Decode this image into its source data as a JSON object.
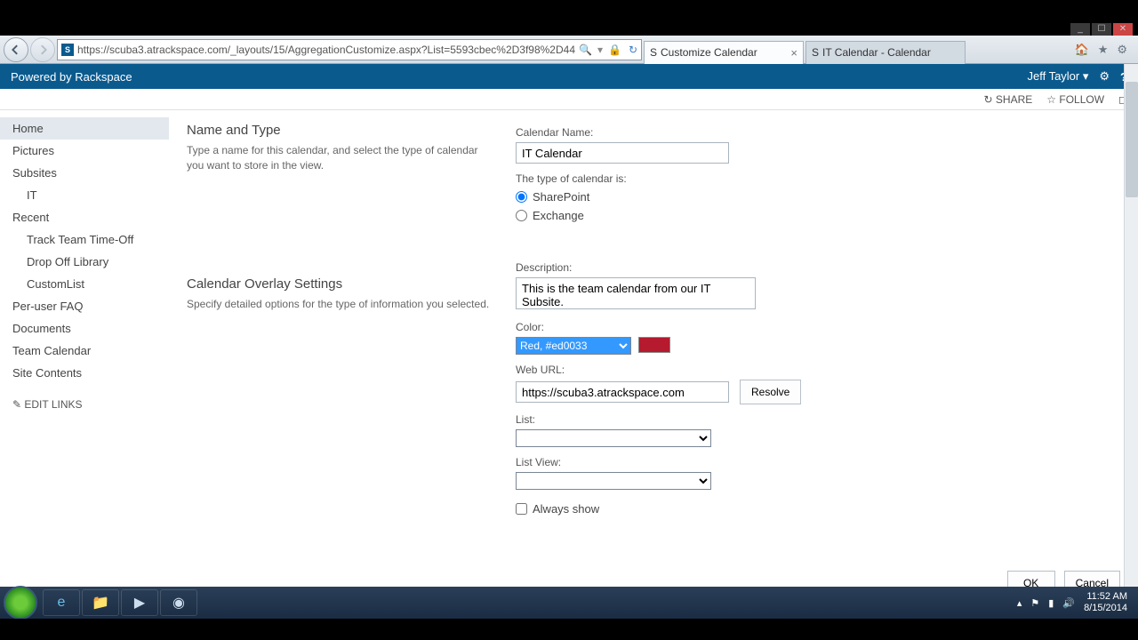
{
  "window": {
    "min": "_",
    "max": "☐",
    "close": "✕"
  },
  "browser": {
    "url": "https://scuba3.atrackspace.com/_layouts/15/AggregationCustomize.aspx?List=5593cbec%2D3f98%2D44",
    "tab1": "Customize Calendar",
    "tab2": "IT Calendar - Calendar"
  },
  "banner": {
    "title": "Powered by Rackspace",
    "user": "Jeff Taylor"
  },
  "ribbon": {
    "share": "SHARE",
    "follow": "FOLLOW"
  },
  "nav": {
    "home": "Home",
    "pictures": "Pictures",
    "subsites": "Subsites",
    "it": "IT",
    "recent": "Recent",
    "track": "Track Team Time-Off",
    "drop": "Drop Off Library",
    "custom": "CustomList",
    "faq": "Per-user FAQ",
    "docs": "Documents",
    "teamcal": "Team Calendar",
    "contents": "Site Contents",
    "edit": "EDIT LINKS"
  },
  "left": {
    "h1": "Name and Type",
    "d1": "Type a name for this calendar, and select the type of calendar you want to store in the view.",
    "h2": "Calendar Overlay Settings",
    "d2": "Specify detailed options for the type of information you selected."
  },
  "form": {
    "calname_lbl": "Calendar Name:",
    "calname_val": "IT Calendar",
    "type_lbl": "The type of calendar is:",
    "type_sp": "SharePoint",
    "type_ex": "Exchange",
    "desc_lbl": "Description:",
    "desc_val": "This is the team calendar from our IT Subsite.",
    "color_lbl": "Color:",
    "color_opt": "Red, #ed0033",
    "color_hex": "#b51a2e",
    "weburl_lbl": "Web URL:",
    "weburl_val": "https://scuba3.atrackspace.com",
    "resolve": "Resolve",
    "list_lbl": "List:",
    "listview_lbl": "List View:",
    "always": "Always show",
    "ok": "OK",
    "cancel": "Cancel"
  },
  "tray": {
    "time": "11:52 AM",
    "date": "8/15/2014"
  }
}
